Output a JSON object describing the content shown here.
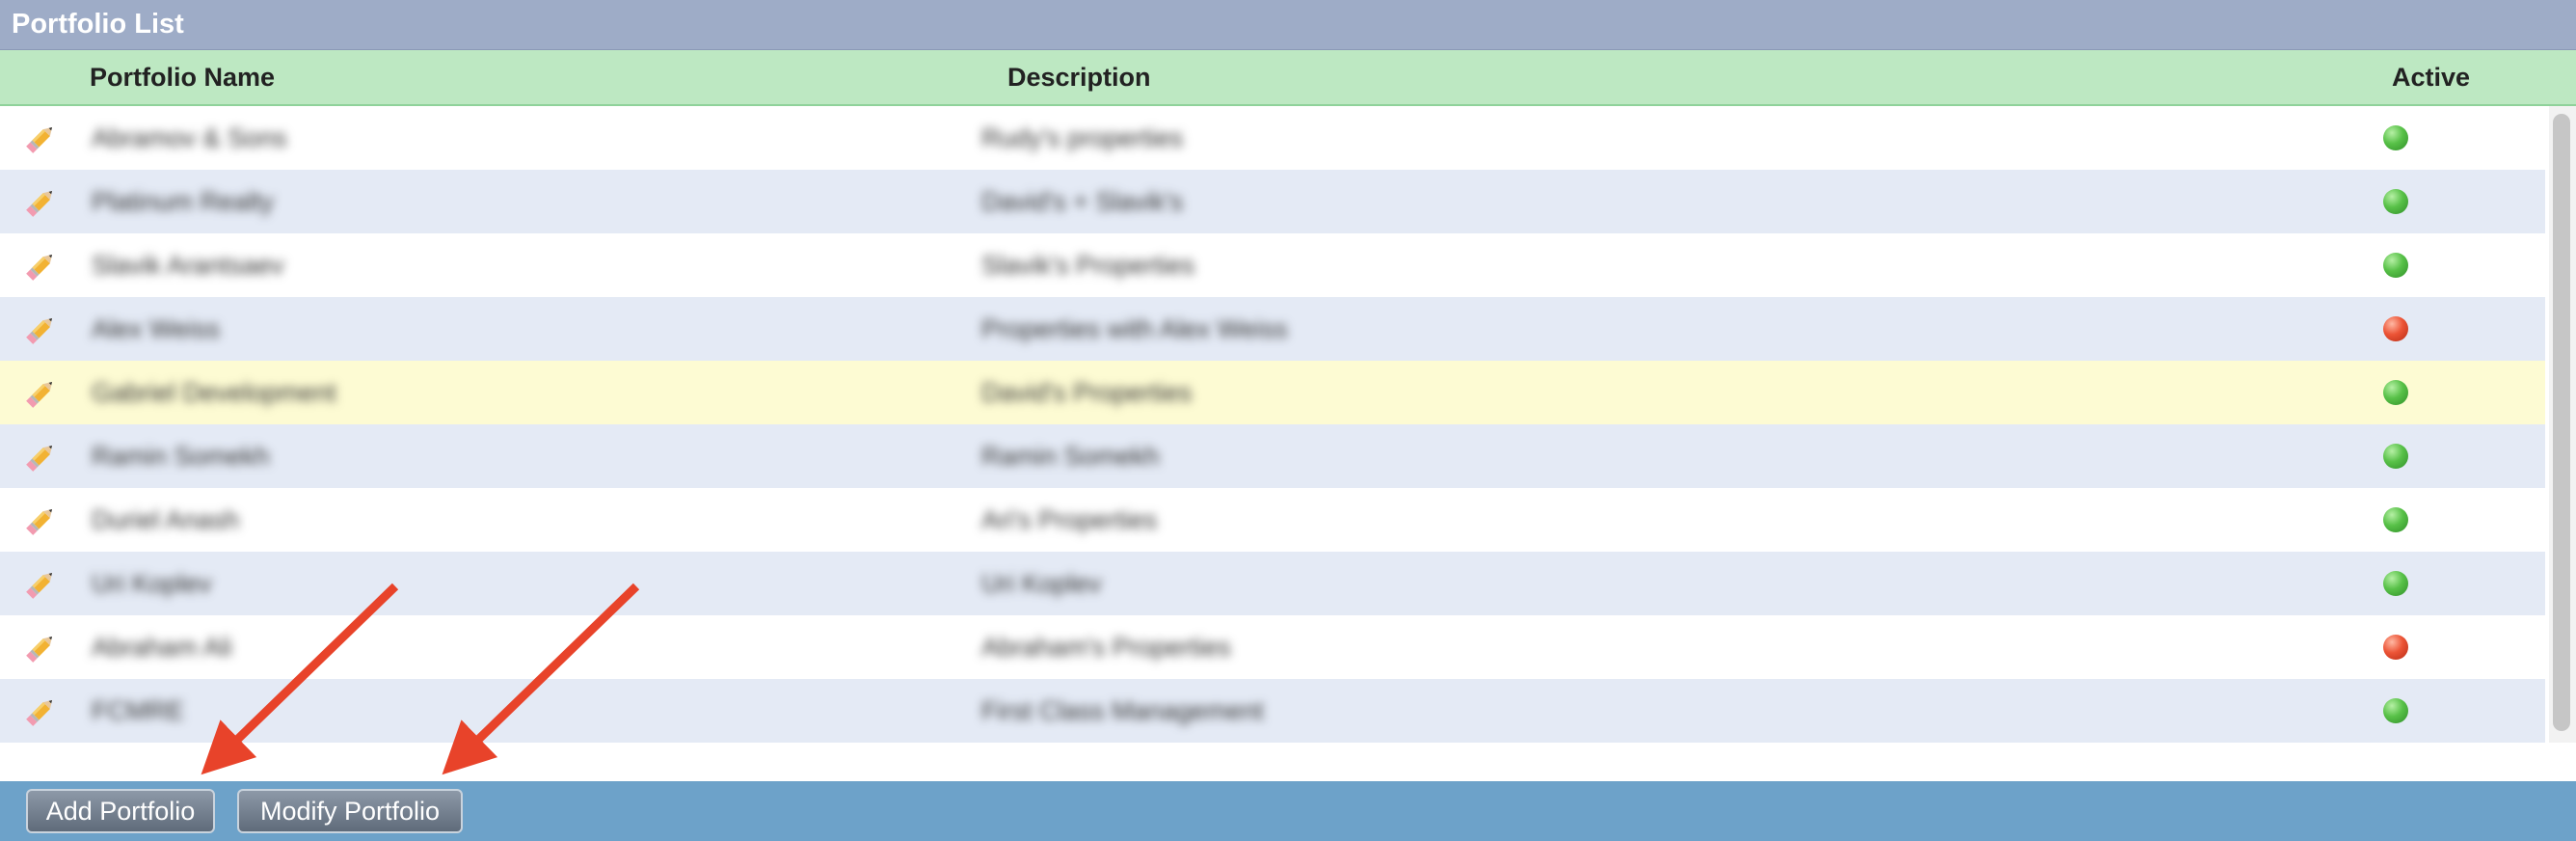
{
  "panel": {
    "title": "Portfolio List"
  },
  "columns": {
    "name": "Portfolio Name",
    "description": "Description",
    "active": "Active"
  },
  "rows": [
    {
      "name": "Abramov & Sons",
      "description": "Rudy's properties",
      "active": true
    },
    {
      "name": "Platinum Realty",
      "description": "David's + Slavik's",
      "active": true
    },
    {
      "name": "Slavik Arantsaev",
      "description": "Slavik's Properties",
      "active": true
    },
    {
      "name": "Alex Weiss",
      "description": "Properties with Alex Weiss",
      "active": false
    },
    {
      "name": "Gabriel Development",
      "description": "David's Properties",
      "active": true,
      "highlighted": true
    },
    {
      "name": "Ramin Somekh",
      "description": "Ramin Somekh",
      "active": true
    },
    {
      "name": "Duriel Anash",
      "description": "Ari's Properties",
      "active": true
    },
    {
      "name": "Uri Koplev",
      "description": "Uri Koplev",
      "active": true
    },
    {
      "name": "Abraham Ali",
      "description": "Abraham's Properties",
      "active": false
    },
    {
      "name": "FCMRE",
      "description": "First Class Management",
      "active": true
    }
  ],
  "toolbar": {
    "add_label": "Add Portfolio",
    "modify_label": "Modify Portfolio"
  },
  "colors": {
    "active": "#4cb944",
    "inactive": "#e34a2e",
    "highlight_row": "#fdfbd3",
    "annotation_arrow": "#e8432a"
  },
  "icons": {
    "edit": "pencil-icon"
  }
}
